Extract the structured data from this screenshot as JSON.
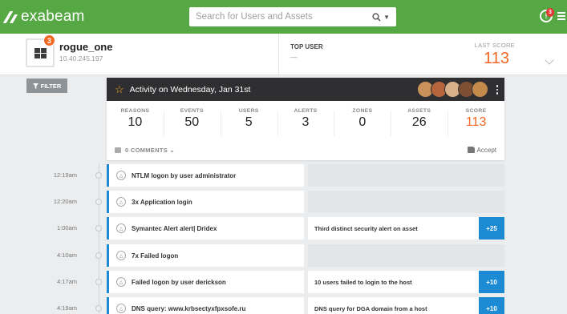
{
  "app": {
    "logo_text": "exabeam"
  },
  "search": {
    "placeholder": "Search for Users and Assets"
  },
  "notifications": {
    "count": "3"
  },
  "entity": {
    "name": "rogue_one",
    "ip": "10.40.245.197",
    "risk_count": "3",
    "top_user_label": "TOP USER",
    "top_user_value": "—",
    "last_score_label": "LAST SCORE",
    "last_score": "113"
  },
  "filter": {
    "label": "FILTER"
  },
  "activity": {
    "title": "Activity on Wednesday, Jan 31st",
    "avatar_colors": [
      "#c9925b",
      "#b5643c",
      "#d8b18a",
      "#7e4f33",
      "#c48a4b"
    ],
    "stats": [
      {
        "label": "REASONS",
        "value": "10"
      },
      {
        "label": "EVENTS",
        "value": "50"
      },
      {
        "label": "USERS",
        "value": "5"
      },
      {
        "label": "ALERTS",
        "value": "3"
      },
      {
        "label": "ZONES",
        "value": "0"
      },
      {
        "label": "ASSETS",
        "value": "26"
      },
      {
        "label": "SCORE",
        "value": "113"
      }
    ],
    "comments_label": "0 COMMENTS",
    "accept_label": "Accept"
  },
  "timeline": [
    {
      "time": "12:19am",
      "event": "NTLM logon by user administrator",
      "rule": "",
      "score": ""
    },
    {
      "time": "12:20am",
      "event": "3x Application login",
      "rule": "",
      "score": ""
    },
    {
      "time": "1:00am",
      "event": "Symantec Alert alert| Dridex",
      "rule": "Third distinct security alert on asset",
      "score": "+25"
    },
    {
      "time": "4:10am",
      "event": "7x Failed logon",
      "rule": "",
      "score": ""
    },
    {
      "time": "4:17am",
      "event": "Failed logon by user derickson",
      "rule": "10 users failed to login to the host",
      "score": "+10"
    },
    {
      "time": "4:19am",
      "event": "DNS query: www.krbsectyxfpxsofe.ru",
      "rule": "DNS query for DGA domain from a host",
      "score": "+10"
    }
  ],
  "colors": {
    "brand": "#55a843",
    "accent": "#f26722",
    "timeline": "#1d8bd4"
  }
}
